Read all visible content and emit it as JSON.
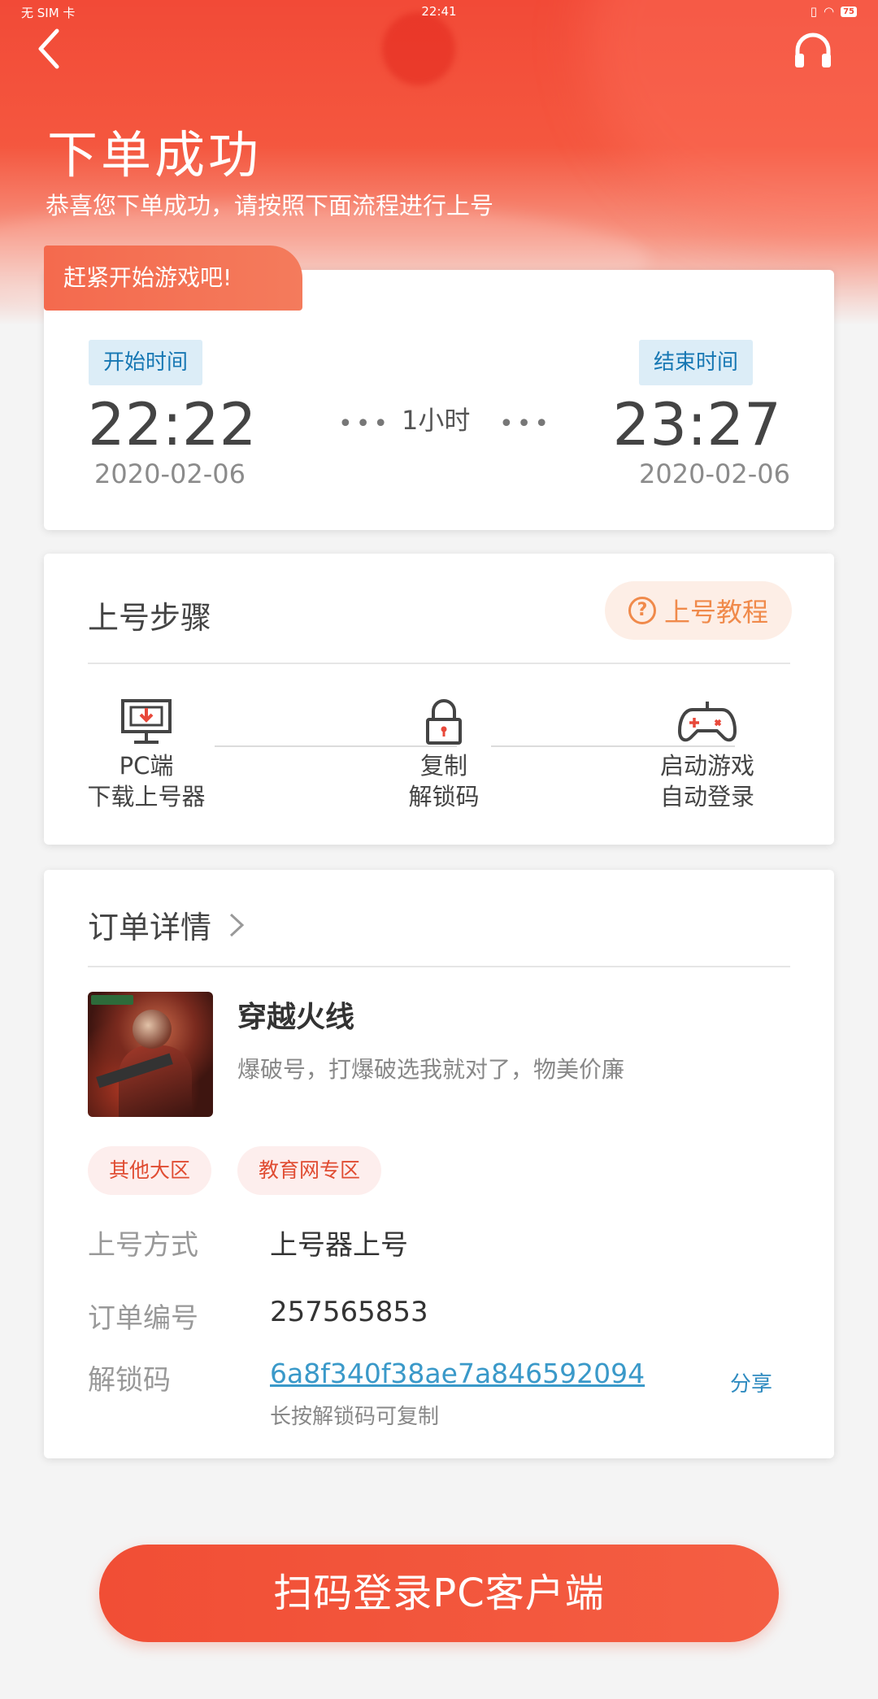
{
  "status_bar": {
    "carrier": "无 SIM 卡",
    "time": "22:41",
    "battery": "75"
  },
  "header": {
    "title": "下单成功",
    "subtitle": "恭喜您下单成功，请按照下面流程进行上号"
  },
  "time_card": {
    "ribbon": "赶紧开始游戏吧!",
    "start_label": "开始时间",
    "start_time": "22:22",
    "start_date": "2020-02-06",
    "duration": "1小时",
    "end_label": "结束时间",
    "end_time": "23:27",
    "end_date": "2020-02-06"
  },
  "steps_card": {
    "title": "上号步骤",
    "tutorial_label": "上号教程",
    "steps": [
      {
        "line1": "PC端",
        "line2": "下载上号器",
        "icon": "monitor-download-icon"
      },
      {
        "line1": "复制",
        "line2": "解锁码",
        "icon": "lock-icon"
      },
      {
        "line1": "启动游戏",
        "line2": "自动登录",
        "icon": "gamepad-icon"
      }
    ]
  },
  "order_card": {
    "title": "订单详情",
    "game_name": "穿越火线",
    "game_desc": "爆破号，打爆破选我就对了，物美价廉",
    "tags": [
      "其他大区",
      "教育网专区"
    ],
    "login_method_label": "上号方式",
    "login_method_value": "上号器上号",
    "order_no_label": "订单编号",
    "order_no_value": "257565853",
    "unlock_label": "解锁码",
    "unlock_code": "6a8f340f38ae7a846592094",
    "unlock_hint": "长按解锁码可复制",
    "share_label": "分享"
  },
  "bottom": {
    "button_label": "扫码登录PC客户端"
  },
  "colors": {
    "accent": "#f24a37",
    "link": "#3a99c9",
    "tag_bg": "#fdeeed",
    "tutorial": "#f08a4b"
  }
}
